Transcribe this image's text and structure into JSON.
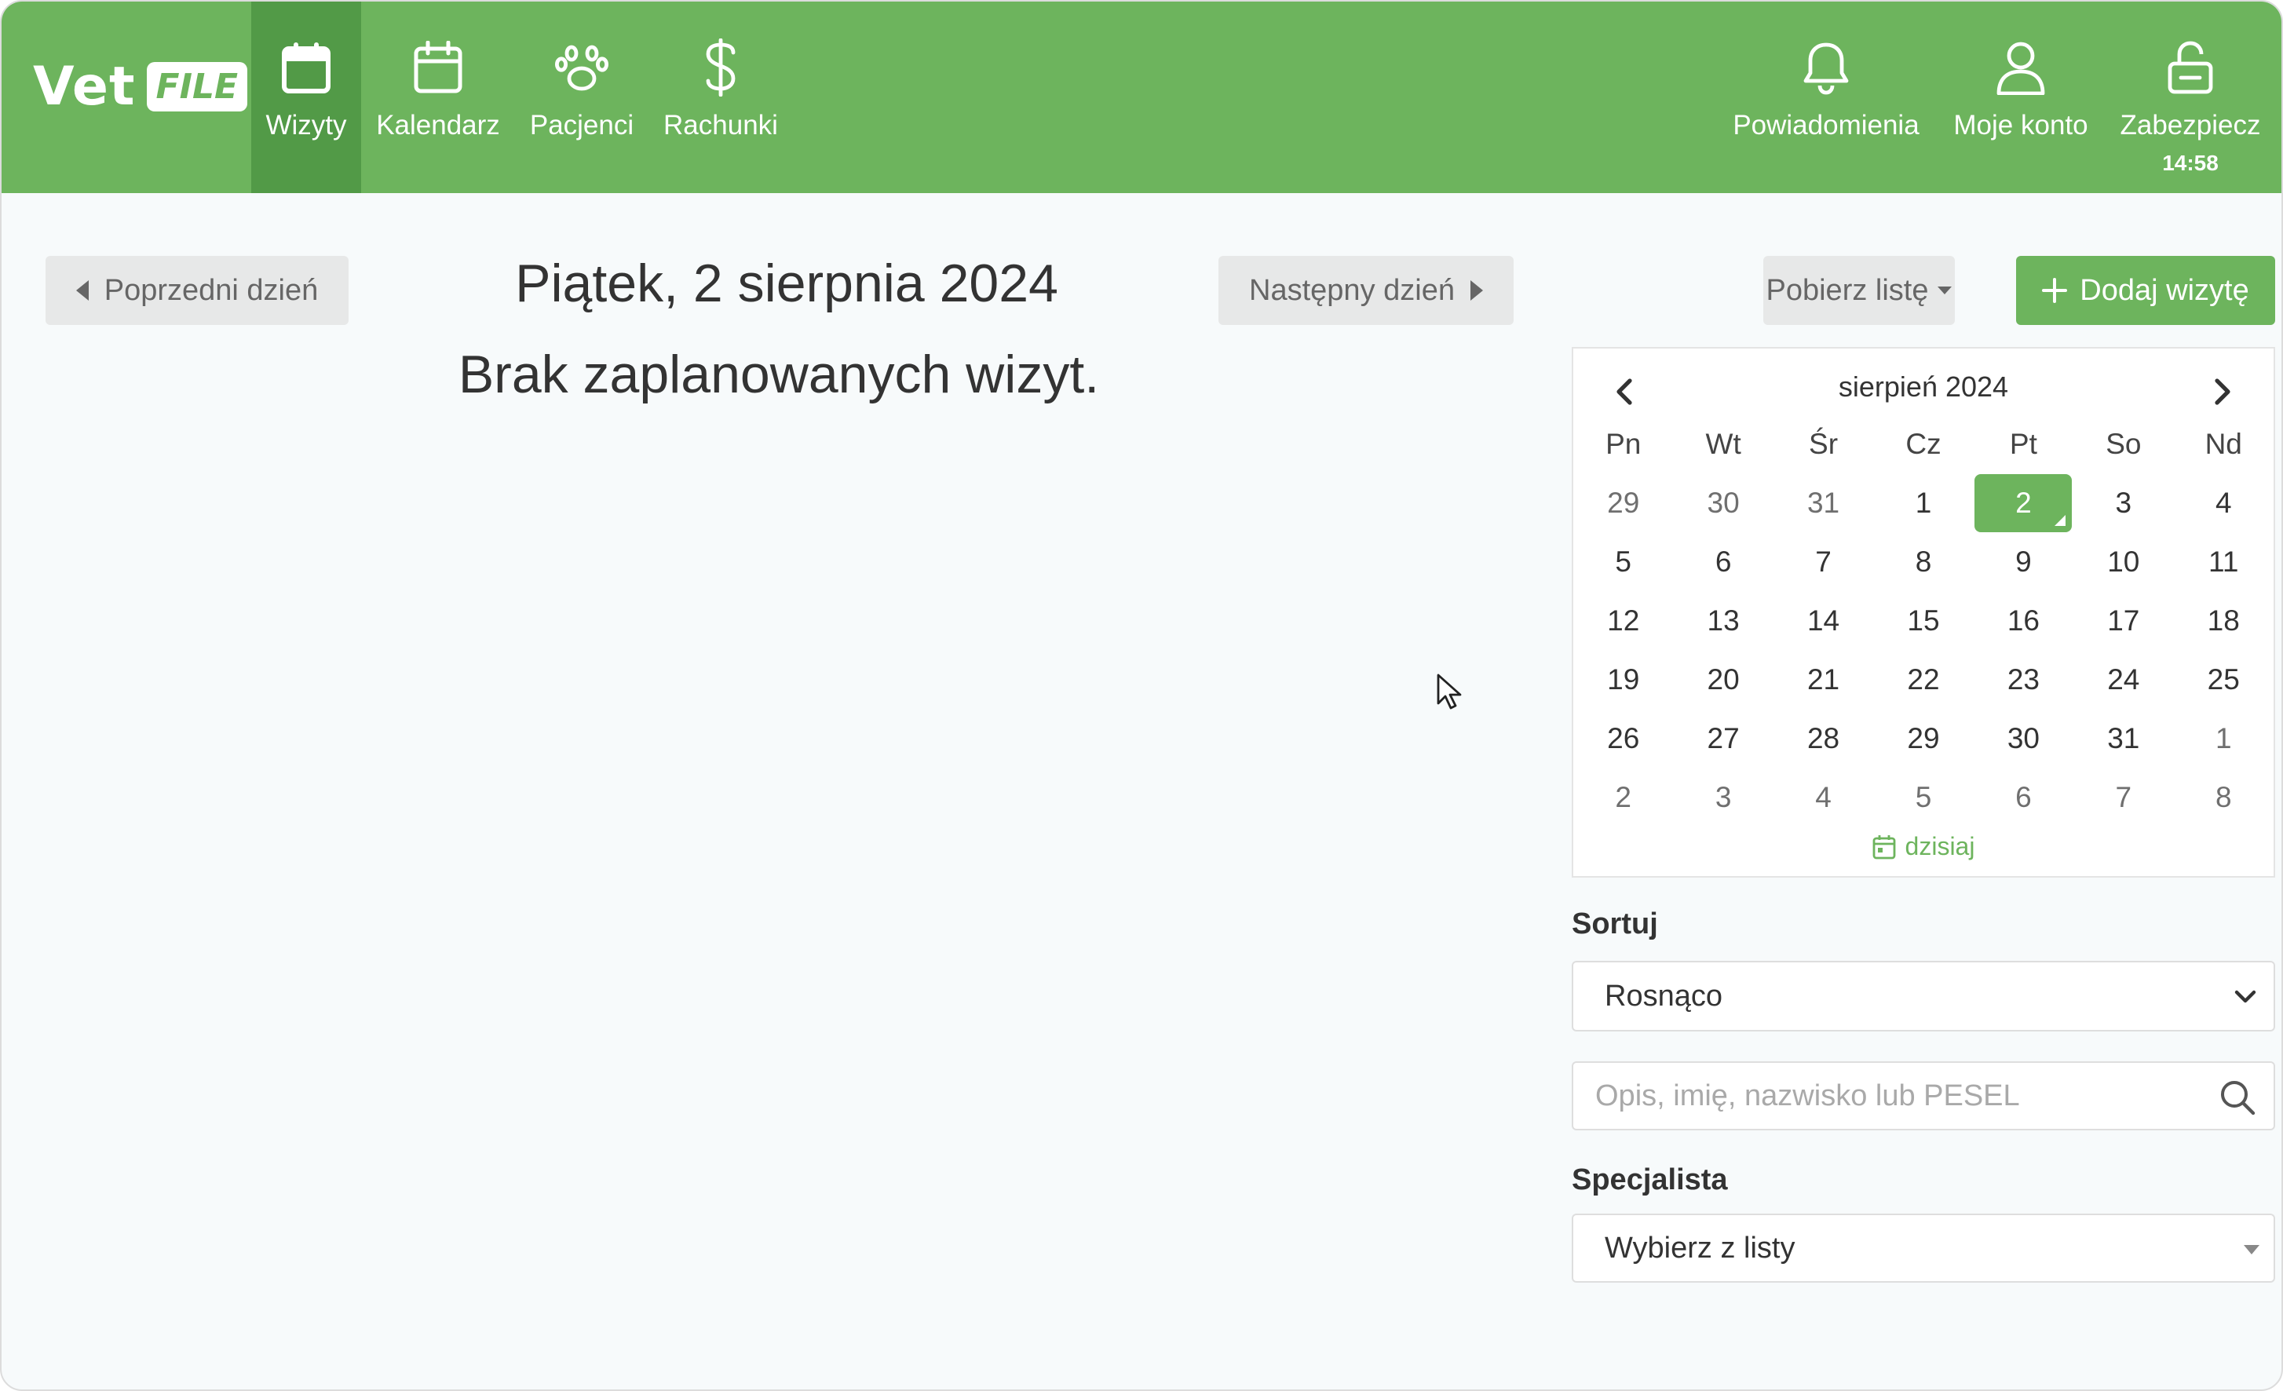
{
  "brand": {
    "name": "Vet",
    "badge": "FILE"
  },
  "nav": {
    "left": [
      {
        "label": "Wizyty",
        "icon": "calendar-filled-icon",
        "active": true
      },
      {
        "label": "Kalendarz",
        "icon": "calendar-icon",
        "active": false
      },
      {
        "label": "Pacjenci",
        "icon": "paw-icon",
        "active": false
      },
      {
        "label": "Rachunki",
        "icon": "dollar-icon",
        "active": false
      }
    ],
    "right": [
      {
        "label": "Powiadomienia",
        "icon": "bell-icon"
      },
      {
        "label": "Moje konto",
        "icon": "user-icon"
      },
      {
        "label": "Zabezpiecz",
        "icon": "lock-icon",
        "sub": "14:58"
      }
    ]
  },
  "toolbar": {
    "prev_day": "Poprzedni dzień",
    "next_day": "Następny dzień",
    "download_list": "Pobierz listę",
    "add_visit": "Dodaj wizytę"
  },
  "main": {
    "date_title": "Piątek, 2 sierpnia 2024",
    "empty_message": "Brak zaplanowanych wizyt."
  },
  "calendar": {
    "title": "sierpień 2024",
    "weekdays": [
      "Pn",
      "Wt",
      "Śr",
      "Cz",
      "Pt",
      "So",
      "Nd"
    ],
    "weeks": [
      [
        [
          "29",
          1
        ],
        [
          "30",
          1
        ],
        [
          "31",
          1
        ],
        [
          "1",
          0
        ],
        [
          "2",
          0
        ],
        [
          "3",
          0
        ],
        [
          "4",
          0
        ]
      ],
      [
        [
          "5",
          0
        ],
        [
          "6",
          0
        ],
        [
          "7",
          0
        ],
        [
          "8",
          0
        ],
        [
          "9",
          0
        ],
        [
          "10",
          0
        ],
        [
          "11",
          0
        ]
      ],
      [
        [
          "12",
          0
        ],
        [
          "13",
          0
        ],
        [
          "14",
          0
        ],
        [
          "15",
          0
        ],
        [
          "16",
          0
        ],
        [
          "17",
          0
        ],
        [
          "18",
          0
        ]
      ],
      [
        [
          "19",
          0
        ],
        [
          "20",
          0
        ],
        [
          "21",
          0
        ],
        [
          "22",
          0
        ],
        [
          "23",
          0
        ],
        [
          "24",
          0
        ],
        [
          "25",
          0
        ]
      ],
      [
        [
          "26",
          0
        ],
        [
          "27",
          0
        ],
        [
          "28",
          0
        ],
        [
          "29",
          0
        ],
        [
          "30",
          0
        ],
        [
          "31",
          0
        ],
        [
          "1",
          1
        ]
      ],
      [
        [
          "2",
          1
        ],
        [
          "3",
          1
        ],
        [
          "4",
          1
        ],
        [
          "5",
          1
        ],
        [
          "6",
          1
        ],
        [
          "7",
          1
        ],
        [
          "8",
          1
        ]
      ]
    ],
    "selected": "2",
    "today_label": "dzisiaj"
  },
  "filters": {
    "sort_label": "Sortuj",
    "sort_value": "Rosnąco",
    "search_placeholder": "Opis, imię, nazwisko lub PESEL",
    "specialist_label": "Specjalista",
    "specialist_value": "Wybierz z listy"
  },
  "colors": {
    "brand": "#6db45d",
    "brand_active": "#529a47"
  }
}
